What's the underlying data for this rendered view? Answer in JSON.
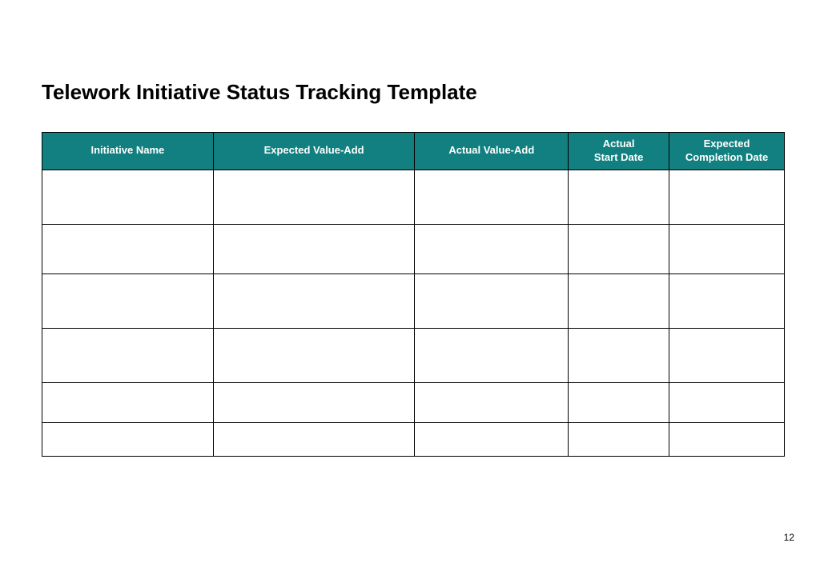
{
  "title": "Telework Initiative Status Tracking Template",
  "pageNumber": "12",
  "table": {
    "headers": [
      "Initiative Name",
      "Expected Value-Add",
      "Actual Value-Add",
      "Actual\nStart Date",
      "Expected\nCompletion Date"
    ],
    "rows": [
      [
        "",
        "",
        "",
        "",
        ""
      ],
      [
        "",
        "",
        "",
        "",
        ""
      ],
      [
        "",
        "",
        "",
        "",
        ""
      ],
      [
        "",
        "",
        "",
        "",
        ""
      ],
      [
        "",
        "",
        "",
        "",
        ""
      ],
      [
        "",
        "",
        "",
        "",
        ""
      ]
    ]
  },
  "colors": {
    "headerBg": "#128080",
    "headerText": "#ffffff",
    "border": "#000000"
  }
}
